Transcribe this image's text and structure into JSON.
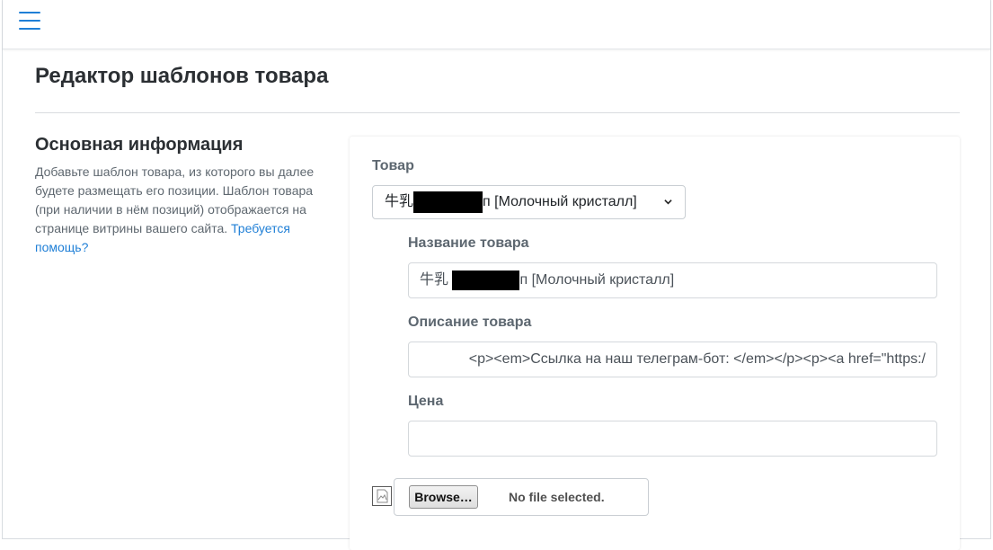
{
  "header": {
    "menu_icon": "hamburger-menu-icon",
    "accent_color": "#1f7fd6"
  },
  "page": {
    "title": "Редактор шаблонов товара"
  },
  "section": {
    "title": "Основная информация",
    "description": "Добавьте шаблон товара, из которого вы далее будете размещать его позиции. Шаблон товара (при наличии в нём позиций) отображается на странице витрины вашего сайта.",
    "help_link": "Требуется помощь?"
  },
  "form": {
    "product": {
      "label": "Товар",
      "value_prefix": "牛乳",
      "value_suffix": "п [Молочный кристалл]"
    },
    "name": {
      "label": "Название товара",
      "value_prefix": "牛乳",
      "value_suffix": "п [Молочный кристалл]"
    },
    "description": {
      "label": "Описание товара",
      "value": "<p><em>Ссылка на наш телеграм-бот: </em></p><p><a href=\"https:/"
    },
    "price": {
      "label": "Цена",
      "value": ""
    },
    "file": {
      "browse_label": "Browse…",
      "status": "No file selected.",
      "icon": "broken-image-icon"
    }
  }
}
